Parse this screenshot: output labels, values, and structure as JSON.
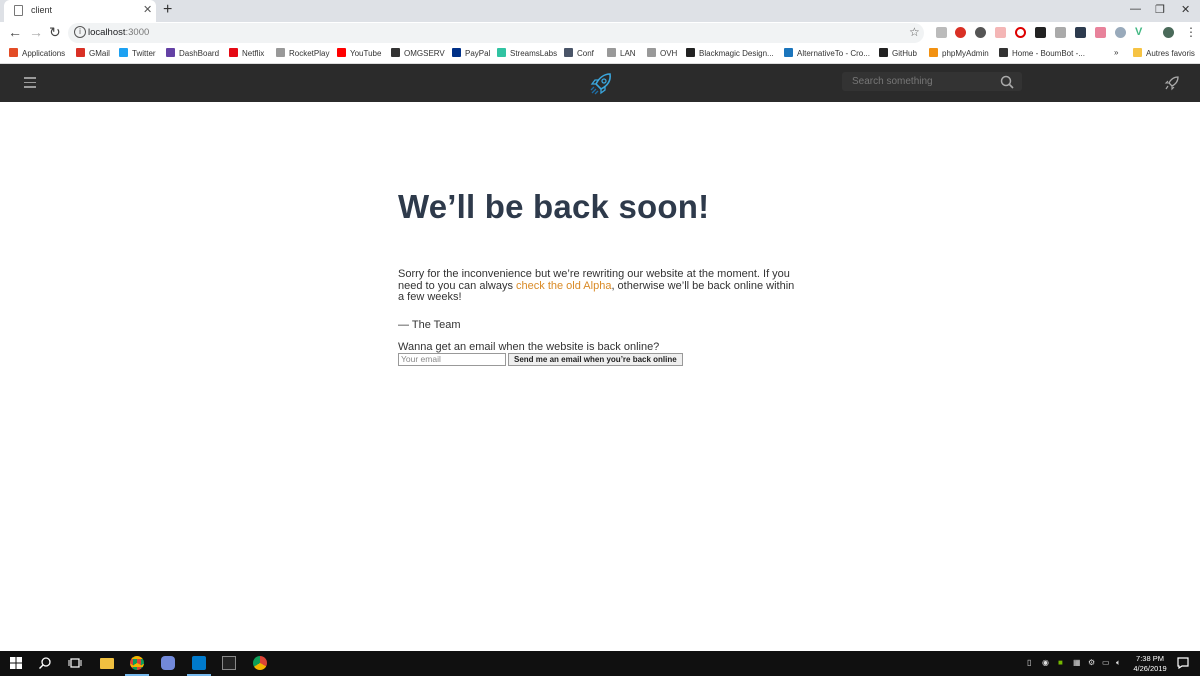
{
  "browser": {
    "tab_title": "client",
    "url_host": "localhost",
    "url_port": ":3000",
    "bookmarks": [
      {
        "label": "Applications",
        "color": "#e34c26"
      },
      {
        "label": "GMail",
        "color": "#d93025"
      },
      {
        "label": "Twitter",
        "color": "#1da1f2"
      },
      {
        "label": "DashBoard",
        "color": "#6441a5"
      },
      {
        "label": "Netflix",
        "color": "#e50914"
      },
      {
        "label": "RocketPlay",
        "color": "#999999"
      },
      {
        "label": "YouTube",
        "color": "#ff0000"
      },
      {
        "label": "OMGSERV",
        "color": "#333333"
      },
      {
        "label": "PayPal",
        "color": "#003087"
      },
      {
        "label": "StreamsLabs",
        "color": "#31c3a2"
      },
      {
        "label": "Conf",
        "color": "#4a5568"
      },
      {
        "label": "LAN",
        "color": "#999999"
      },
      {
        "label": "OVH",
        "color": "#999999"
      },
      {
        "label": "Blackmagic Design...",
        "color": "#222222"
      },
      {
        "label": "AlternativeTo - Cro...",
        "color": "#1b75bc"
      },
      {
        "label": "GitHub",
        "color": "#222222"
      },
      {
        "label": "phpMyAdmin",
        "color": "#f29111"
      },
      {
        "label": "Home - BoumBot -...",
        "color": "#333333"
      },
      {
        "label": "Autres favoris",
        "color": "#f6c343"
      }
    ],
    "overflow_label": "»"
  },
  "header": {
    "search_placeholder": "Search something"
  },
  "main": {
    "headline": "We’ll be back soon!",
    "message_before_link": "Sorry for the inconvenience but we’re rewriting our website at the moment. If you need to you can always ",
    "link_text": "check the old Alpha",
    "message_after_link": ", otherwise we’ll be back online within a few weeks!",
    "signoff": "— The Team",
    "email_prompt": "Wanna get an email when the website is back online?",
    "email_placeholder": "Your email",
    "email_button": "Send me an email when you’re back online",
    "accent_color": "#d98a26",
    "headline_color": "#2e3a4b"
  },
  "taskbar": {
    "time": "7:38 PM",
    "date": "4/26/2019"
  }
}
